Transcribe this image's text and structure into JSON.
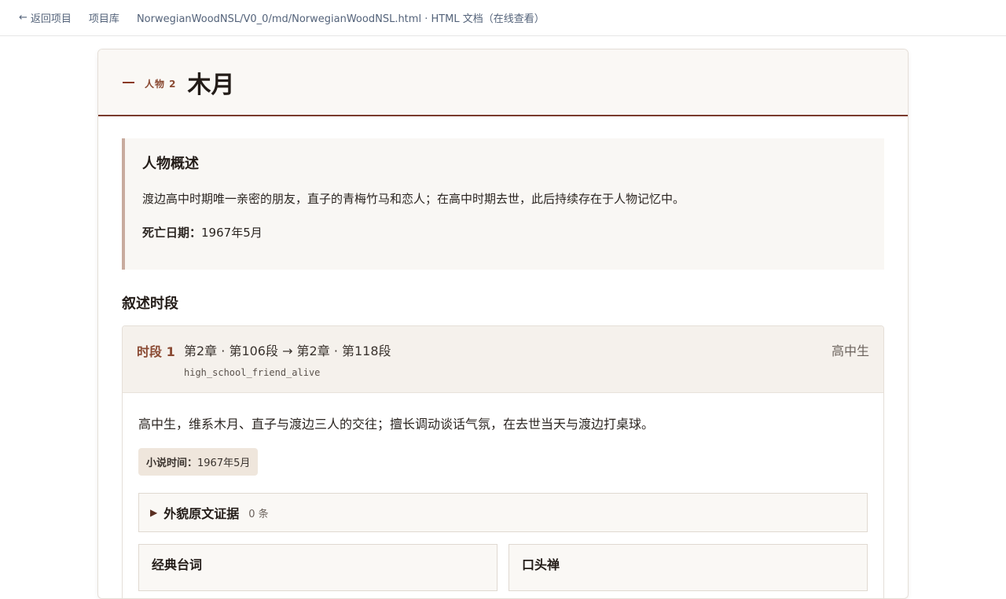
{
  "topbar": {
    "back_label": "返回项目",
    "library_label": "项目库",
    "path": "NorwegianWoodNSL/V0_0/md/NorwegianWoodNSL.html · HTML 文档（在线查看）"
  },
  "character": {
    "kicker": "人物 2",
    "name": "木月"
  },
  "summary": {
    "heading": "人物概述",
    "description": "渡边高中时期唯一亲密的朋友，直子的青梅竹马和恋人；在高中时期去世，此后持续存在于人物记忆中。",
    "death_label": "死亡日期：",
    "death_value": "1967年5月"
  },
  "timeline": {
    "heading": "叙述时段",
    "segments": [
      {
        "label": "时段 1",
        "range": "第2章 · 第106段 → 第2章 · 第118段",
        "code": "high_school_friend_alive",
        "role": "高中生",
        "description": "高中生，维系木月、直子与渡边三人的交往；擅长调动谈话气氛，在去世当天与渡边打桌球。",
        "time_label": "小说时间：",
        "time_value": "1967年5月",
        "evidence_title": "外貌原文证据",
        "evidence_count": "0 条",
        "quotes_title": "经典台词",
        "catchphrase_title": "口头禅"
      }
    ]
  }
}
